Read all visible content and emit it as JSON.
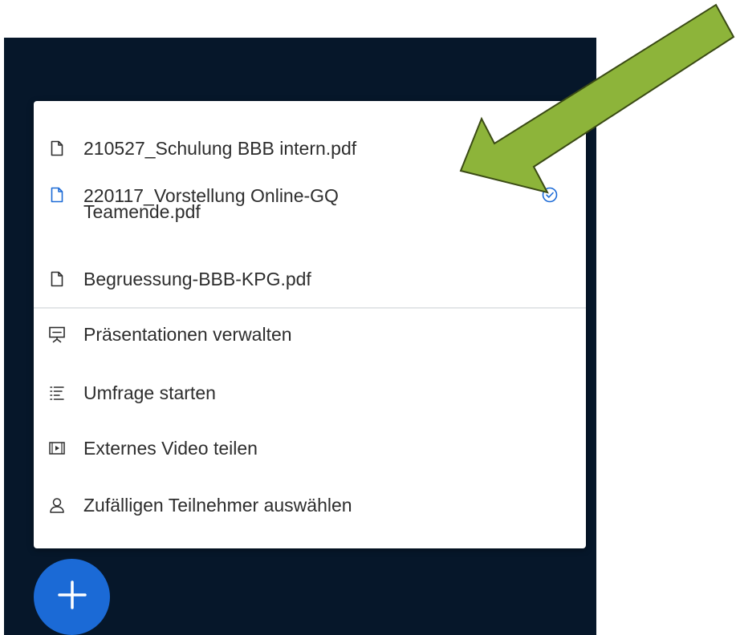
{
  "menu": {
    "presentations": [
      {
        "label": "210527_Schulung BBB intern.pdf",
        "icon": "file-icon",
        "selected": false
      },
      {
        "label_line1": "220117_Vorstellung Online-GQ",
        "label_line2": "Teamende.pdf",
        "icon": "file-icon",
        "selected": true,
        "status_icon": "check-circle-icon"
      },
      {
        "label": "Begruessung-BBB-KPG.pdf",
        "icon": "file-icon",
        "selected": false
      }
    ],
    "actions": [
      {
        "label": "Präsentationen verwalten",
        "icon": "presentation-icon"
      },
      {
        "label": "Umfrage starten",
        "icon": "poll-icon"
      },
      {
        "label": "Externes Video teilen",
        "icon": "video-icon"
      },
      {
        "label": "Zufälligen Teilnehmer auswählen",
        "icon": "user-icon"
      }
    ]
  },
  "fab": {
    "icon": "plus-icon"
  },
  "colors": {
    "panel_bg": "#06172a",
    "accent": "#1b6ad6",
    "arrow_fill": "#8db43a",
    "arrow_stroke": "#3a4a14"
  }
}
